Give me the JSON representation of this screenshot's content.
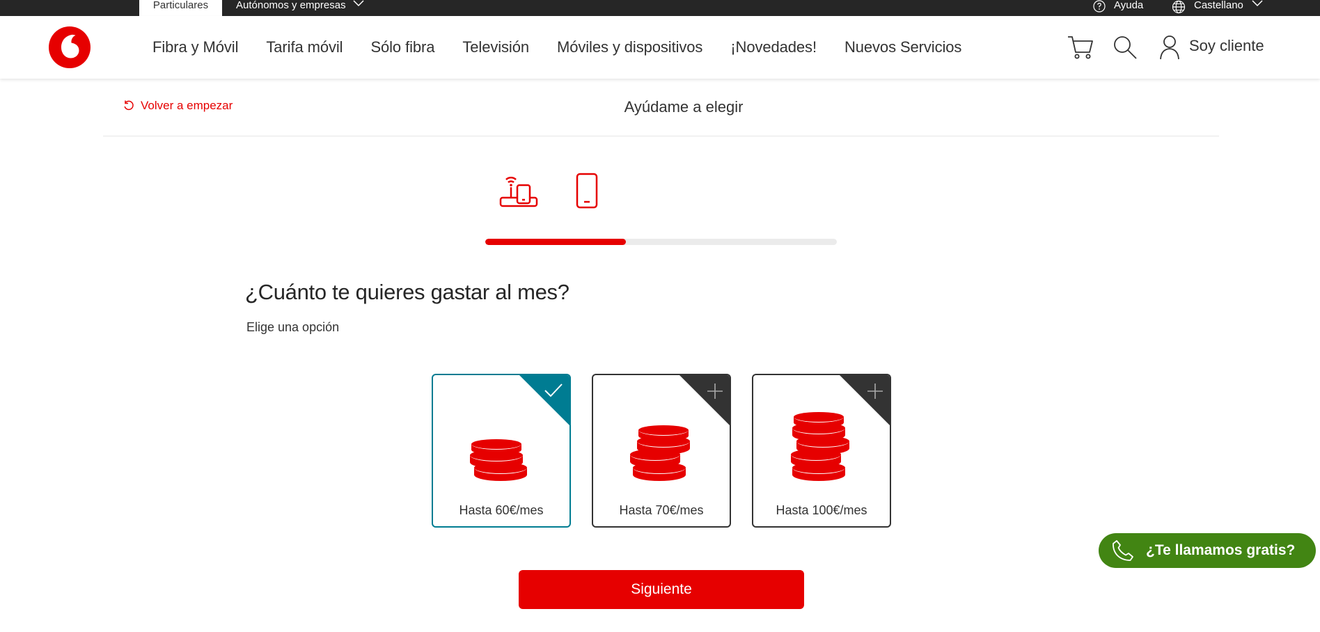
{
  "topbar": {
    "particulares": "Particulares",
    "autonomos": "Autónomos y empresas",
    "ayuda": "Ayuda",
    "language": "Castellano"
  },
  "header": {
    "nav": [
      "Fibra y Móvil",
      "Tarifa móvil",
      "Sólo fibra",
      "Televisión",
      "Móviles y dispositivos",
      "¡Novedades!",
      "Nuevos Servicios"
    ],
    "soy_cliente": "Soy cliente"
  },
  "subheader": {
    "restart": "Volver a empezar",
    "title": "Ayúdame a elegir"
  },
  "progress": {
    "fraction": 0.4
  },
  "question": {
    "title": "¿Cuánto te quieres gastar al mes?",
    "hint": "Elige una opción"
  },
  "options": [
    {
      "label": "Hasta 60€/mes",
      "selected": true
    },
    {
      "label": "Hasta 70€/mes",
      "selected": false
    },
    {
      "label": "Hasta 100€/mes",
      "selected": false
    }
  ],
  "next_button": "Siguiente",
  "call_button": "¿Te llamamos gratis?",
  "colors": {
    "brand_red": "#e60000",
    "selected_teal": "#007c92",
    "call_green": "#428513",
    "topbar_dark": "#262626"
  }
}
